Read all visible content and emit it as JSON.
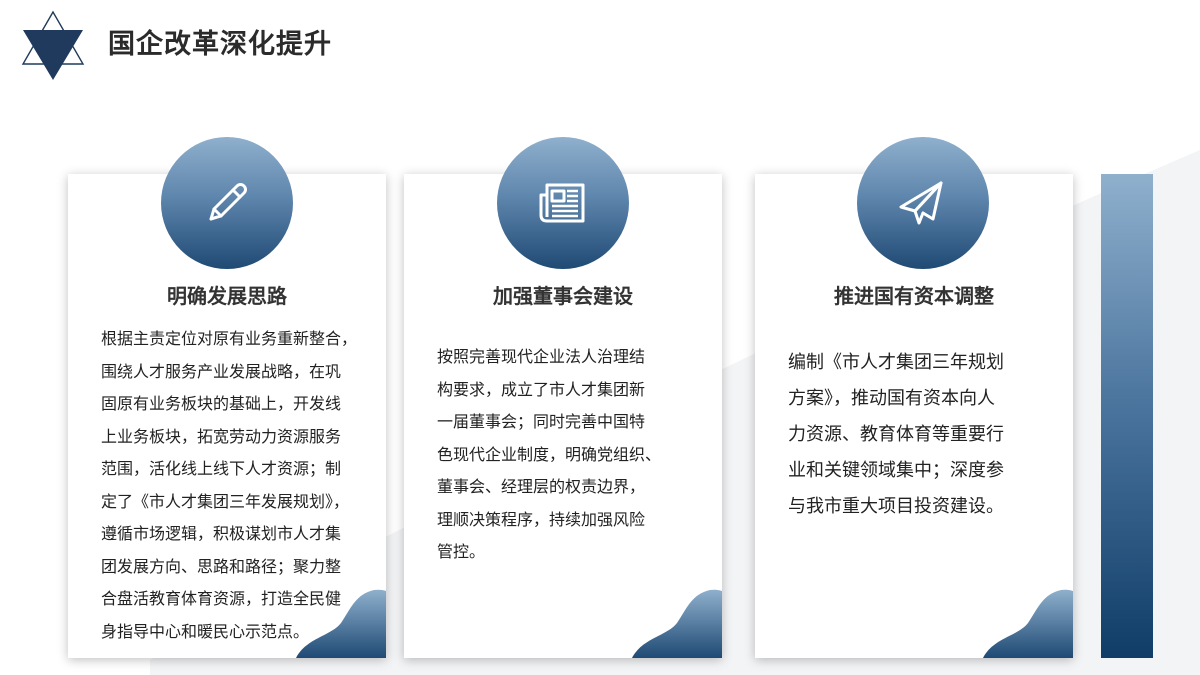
{
  "header": {
    "title": "国企改革深化提升"
  },
  "colors": {
    "accent_light": "#8fb0cd",
    "accent_dark": "#1f4a74",
    "text": "#222222"
  },
  "cards": [
    {
      "icon": "pencil-icon",
      "heading": "明确发展思路",
      "lines": [
        "根据主责定位对原有业务重新整合，",
        "围绕人才服务产业发展战略，在巩",
        "固原有业务板块的基础上，开发线",
        "上业务板块，拓宽劳动力资源服务",
        "范围，活化线上线下人才资源；制",
        "定了《市人才集团三年发展规划》，",
        "遵循市场逻辑，积极谋划市人才集",
        "团发展方向、思路和路径；聚力整",
        "合盘活教育体育资源，打造全民健",
        "身指导中心和暖民心示范点。"
      ]
    },
    {
      "icon": "newspaper-icon",
      "heading": "加强董事会建设",
      "lines": [
        "按照完善现代企业法人治理结",
        "构要求，成立了市人才集团新",
        "一届董事会；同时完善中国特",
        "色现代企业制度，明确党组织、",
        "董事会、经理层的权责边界，",
        "理顺决策程序，持续加强风险",
        "管控。"
      ]
    },
    {
      "icon": "paper-plane-icon",
      "heading": "推进国有资本调整",
      "lines": [
        "编制《市人才集团三年规划",
        "方案》，推动国有资本向人",
        "力资源、教育体育等重要行",
        "业和关键领域集中；深度参",
        "与我市重大项目投资建设。"
      ]
    }
  ]
}
